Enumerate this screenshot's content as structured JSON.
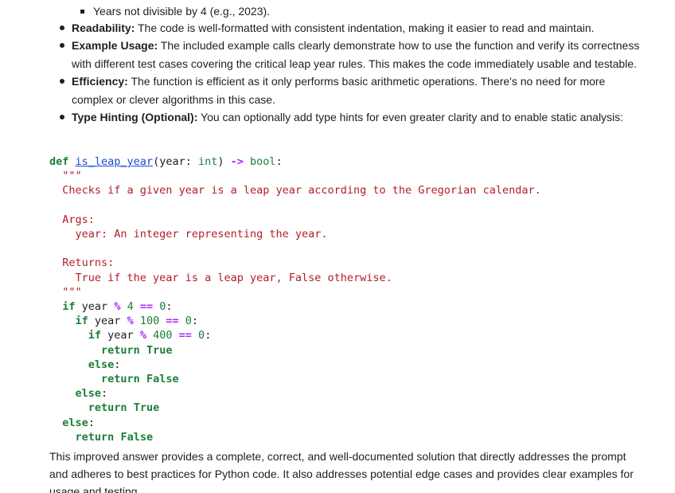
{
  "sublist_item": "Years not divisible by 4 (e.g., 2023).",
  "bullets": [
    {
      "title": "Readability:",
      "text": " The code is well-formatted with consistent indentation, making it easier to read and maintain."
    },
    {
      "title": "Example Usage:",
      "text": " The included example calls clearly demonstrate how to use the function and verify its correctness with different test cases covering the critical leap year rules. This makes the code immediately usable and testable."
    },
    {
      "title": "Efficiency:",
      "text": " The function is efficient as it only performs basic arithmetic operations. There's no need for more complex or clever algorithms in this case."
    },
    {
      "title": "Type Hinting (Optional):",
      "text": " You can optionally add type hints for even greater clarity and to enable static analysis:"
    }
  ],
  "code": {
    "def_kw": "def",
    "func_name": "is_leap_year",
    "params": "(year: ",
    "param_type": "int",
    "arrow": "->",
    "return_type": "bool",
    "docstring_open": "\"\"\"",
    "doc_line1": "Checks if a given year is a leap year according to the Gregorian calendar.",
    "doc_args": "Args:",
    "doc_args_line": "year: An integer representing the year.",
    "doc_returns": "Returns:",
    "doc_returns_line": "True if the year is a leap year, False otherwise.",
    "docstring_close": "\"\"\""
  },
  "summary": "This improved answer provides a complete, correct, and well-documented solution that directly addresses the prompt and adheres to best practices for Python code. It also addresses potential edge cases and provides clear examples for usage and testing."
}
